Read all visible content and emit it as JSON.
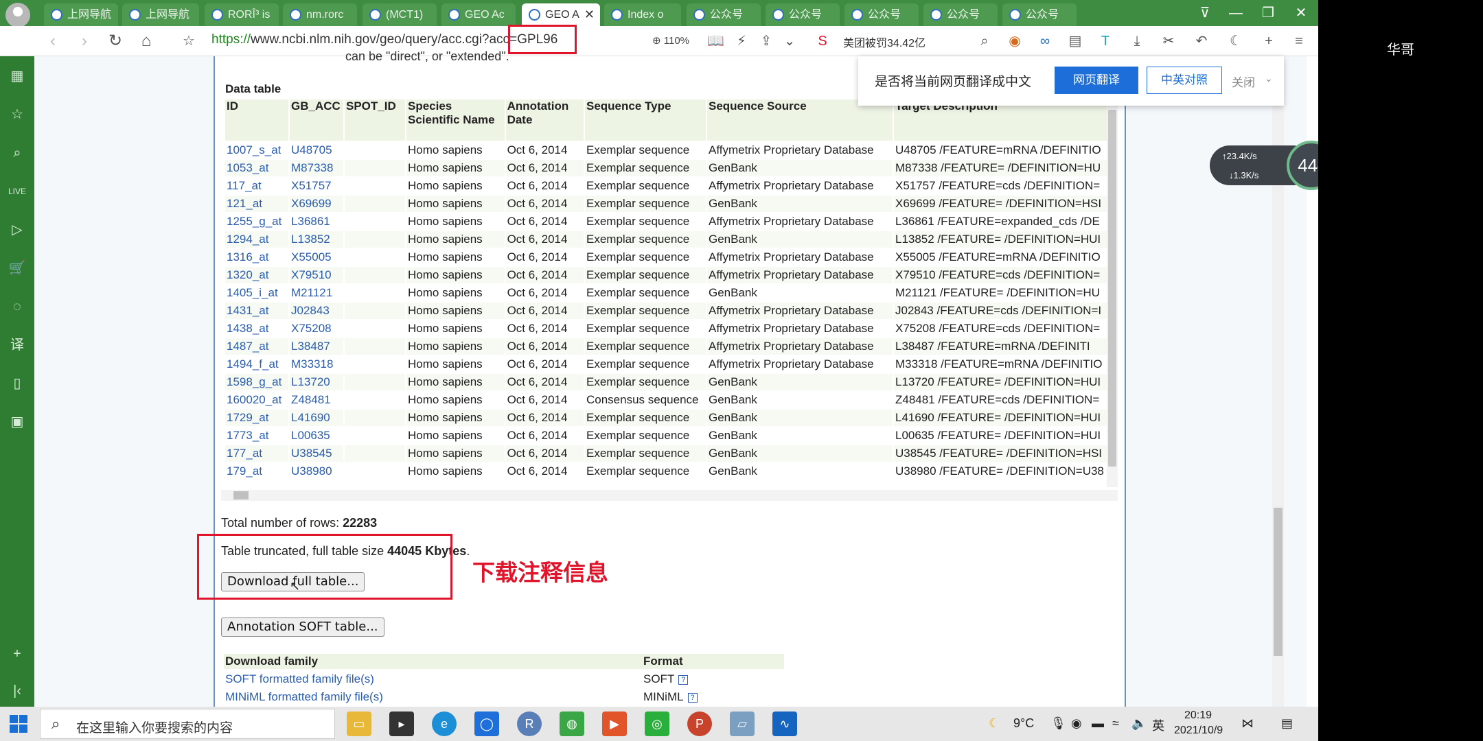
{
  "user": {
    "name": "华哥"
  },
  "tabs": [
    {
      "label": "上网导航"
    },
    {
      "label": "上网导航"
    },
    {
      "label": "RORÎ³ is"
    },
    {
      "label": "nm.rorc"
    },
    {
      "label": "(MCT1)"
    },
    {
      "label": "GEO Ac"
    },
    {
      "label": "GEO A",
      "active": true
    },
    {
      "label": "Index o"
    },
    {
      "label": "公众号"
    },
    {
      "label": "公众号"
    },
    {
      "label": "公众号"
    },
    {
      "label": "公众号"
    },
    {
      "label": "公众号"
    }
  ],
  "address": {
    "scheme": "https://",
    "rest": "www.ncbi.nlm.nih.gov/geo/query/acc.cgi?acc=GPL96",
    "zoom": "110%",
    "news": "美团被罚34.42亿"
  },
  "translate": {
    "question": "是否将当前网页翻译成中文",
    "translate_btn": "网页翻译",
    "bilingual_btn": "中英对照",
    "close": "关闭"
  },
  "net": {
    "up": "23.4K/s",
    "down": "1.3K/s",
    "percent": "44"
  },
  "page": {
    "clipped_line": "can be \"direct\", or \"extended\".",
    "table_title": "Data table",
    "columns": [
      "ID",
      "GB_ACC",
      "SPOT_ID",
      "Species Scientific Name",
      "Annotation Date",
      "Sequence Type",
      "Sequence Source",
      "Target Description"
    ],
    "rows": [
      [
        "1007_s_at",
        "U48705",
        "",
        "Homo sapiens",
        "Oct 6, 2014",
        "Exemplar sequence",
        "Affymetrix Proprietary Database",
        "U48705 /FEATURE=mRNA /DEFINITIO"
      ],
      [
        "1053_at",
        "M87338",
        "",
        "Homo sapiens",
        "Oct 6, 2014",
        "Exemplar sequence",
        "GenBank",
        "M87338 /FEATURE= /DEFINITION=HU"
      ],
      [
        "117_at",
        "X51757",
        "",
        "Homo sapiens",
        "Oct 6, 2014",
        "Exemplar sequence",
        "Affymetrix Proprietary Database",
        "X51757 /FEATURE=cds /DEFINITION="
      ],
      [
        "121_at",
        "X69699",
        "",
        "Homo sapiens",
        "Oct 6, 2014",
        "Exemplar sequence",
        "GenBank",
        "X69699 /FEATURE= /DEFINITION=HSI"
      ],
      [
        "1255_g_at",
        "L36861",
        "",
        "Homo sapiens",
        "Oct 6, 2014",
        "Exemplar sequence",
        "Affymetrix Proprietary Database",
        "L36861 /FEATURE=expanded_cds /DE"
      ],
      [
        "1294_at",
        "L13852",
        "",
        "Homo sapiens",
        "Oct 6, 2014",
        "Exemplar sequence",
        "GenBank",
        "L13852 /FEATURE= /DEFINITION=HUI"
      ],
      [
        "1316_at",
        "X55005",
        "",
        "Homo sapiens",
        "Oct 6, 2014",
        "Exemplar sequence",
        "Affymetrix Proprietary Database",
        "X55005 /FEATURE=mRNA /DEFINITIO"
      ],
      [
        "1320_at",
        "X79510",
        "",
        "Homo sapiens",
        "Oct 6, 2014",
        "Exemplar sequence",
        "Affymetrix Proprietary Database",
        "X79510 /FEATURE=cds /DEFINITION="
      ],
      [
        "1405_i_at",
        "M21121",
        "",
        "Homo sapiens",
        "Oct 6, 2014",
        "Exemplar sequence",
        "GenBank",
        "M21121 /FEATURE= /DEFINITION=HU"
      ],
      [
        "1431_at",
        "J02843",
        "",
        "Homo sapiens",
        "Oct 6, 2014",
        "Exemplar sequence",
        "Affymetrix Proprietary Database",
        "J02843 /FEATURE=cds /DEFINITION=I"
      ],
      [
        "1438_at",
        "X75208",
        "",
        "Homo sapiens",
        "Oct 6, 2014",
        "Exemplar sequence",
        "Affymetrix Proprietary Database",
        "X75208 /FEATURE=cds /DEFINITION="
      ],
      [
        "1487_at",
        "L38487",
        "",
        "Homo sapiens",
        "Oct 6, 2014",
        "Exemplar sequence",
        "Affymetrix Proprietary Database",
        "L38487 /FEATURE=mRNA /DEFINITI"
      ],
      [
        "1494_f_at",
        "M33318",
        "",
        "Homo sapiens",
        "Oct 6, 2014",
        "Exemplar sequence",
        "Affymetrix Proprietary Database",
        "M33318 /FEATURE=mRNA /DEFINITIO"
      ],
      [
        "1598_g_at",
        "L13720",
        "",
        "Homo sapiens",
        "Oct 6, 2014",
        "Exemplar sequence",
        "GenBank",
        "L13720 /FEATURE= /DEFINITION=HUI"
      ],
      [
        "160020_at",
        "Z48481",
        "",
        "Homo sapiens",
        "Oct 6, 2014",
        "Consensus sequence",
        "GenBank",
        "Z48481 /FEATURE=cds /DEFINITION="
      ],
      [
        "1729_at",
        "L41690",
        "",
        "Homo sapiens",
        "Oct 6, 2014",
        "Exemplar sequence",
        "GenBank",
        "L41690 /FEATURE= /DEFINITION=HUI"
      ],
      [
        "1773_at",
        "L00635",
        "",
        "Homo sapiens",
        "Oct 6, 2014",
        "Exemplar sequence",
        "GenBank",
        "L00635 /FEATURE= /DEFINITION=HUI"
      ],
      [
        "177_at",
        "U38545",
        "",
        "Homo sapiens",
        "Oct 6, 2014",
        "Exemplar sequence",
        "GenBank",
        "U38545 /FEATURE= /DEFINITION=HSI"
      ],
      [
        "179_at",
        "U38980",
        "",
        "Homo sapiens",
        "Oct 6, 2014",
        "Exemplar sequence",
        "GenBank",
        "U38980 /FEATURE= /DEFINITION=U38"
      ]
    ],
    "total_rows_label": "Total number of rows: ",
    "total_rows_value": "22283",
    "truncated_prefix": "Table truncated, full table size ",
    "truncated_value": "44045 Kbytes",
    "truncated_suffix": ".",
    "download_btn": "Download full table...",
    "annotation_note": "下载注释信息",
    "annot_soft_btn": "Annotation SOFT table...",
    "download_family": {
      "header_family": "Download family",
      "header_format": "Format",
      "items": [
        {
          "label": "SOFT formatted family file(s)",
          "format": "SOFT"
        },
        {
          "label": "MINiML formatted family file(s)",
          "format": "MINiML"
        }
      ]
    }
  },
  "taskbar": {
    "search_placeholder": "在这里输入你要搜索的内容",
    "weather": "9°C",
    "ime": "英",
    "time": "20:19",
    "date": "2021/10/9"
  },
  "colors": {
    "brand_green": "#3e8c41",
    "link": "#2a5db0",
    "highlight_red": "#e0142a",
    "translate_blue": "#1d6ed9"
  }
}
